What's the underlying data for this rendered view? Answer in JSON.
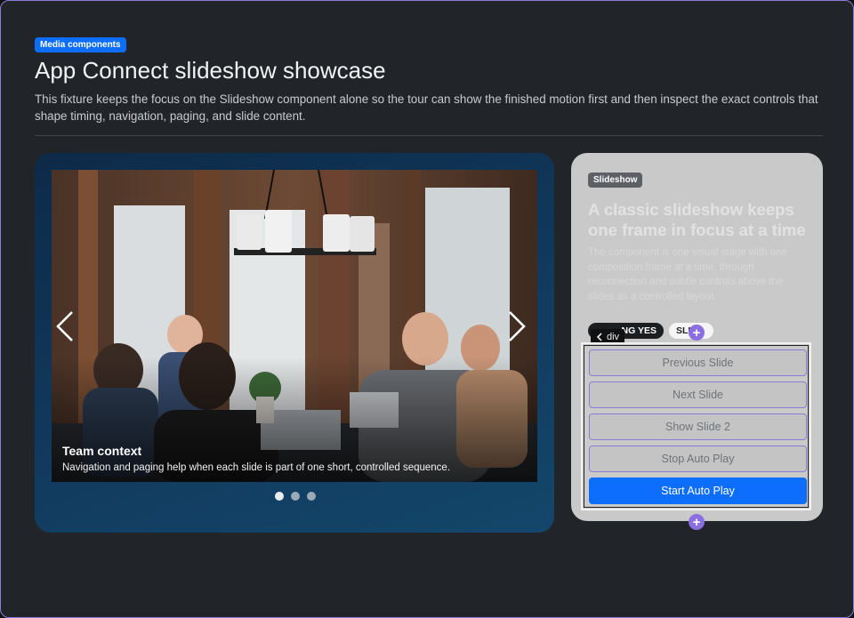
{
  "header": {
    "badge": "Media components",
    "title": "App Connect slideshow showcase",
    "description": "This fixture keeps the focus on the Slideshow component alone so the tour can show the finished motion first and then inspect the exact controls that shape timing, navigation, paging, and slide content."
  },
  "slideshow": {
    "active_slide": 1,
    "slide_count": 3,
    "caption_title": "Team context",
    "caption_text": "Navigation and paging help when each slide is part of one short, controlled sequence.",
    "prev_icon": "chevron-left-icon",
    "next_icon": "chevron-right-icon"
  },
  "side_card": {
    "tag": "Slideshow",
    "heading": "A classic slideshow keeps one frame in focus at a time",
    "body": "The component is one visual stage with one composition frame at a time, through reconnection and subtle controls above the slides as a controlled layout.",
    "pill_autoplay": "NG YES",
    "pill_slide": "SLI"
  },
  "inspector": {
    "element_tag": "div",
    "back_icon": "chevron-left-icon",
    "add_icon": "plus-icon"
  },
  "controls": [
    {
      "label": "Previous Slide"
    },
    {
      "label": "Next Slide"
    },
    {
      "label": "Show Slide 2"
    },
    {
      "label": "Stop Auto Play"
    },
    {
      "label": "Start Auto Play"
    }
  ],
  "colors": {
    "accent": "#0d6efd",
    "inspector": "#8b6fe0",
    "stage": "#113a5e",
    "page_bg": "#212529"
  }
}
